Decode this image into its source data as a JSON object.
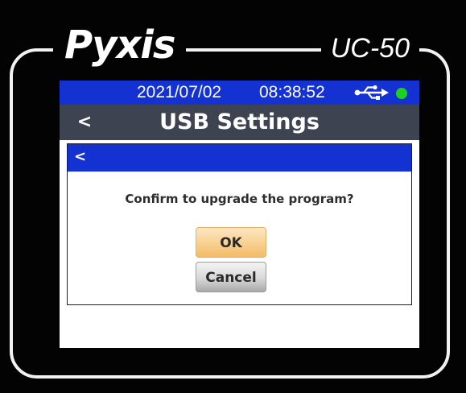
{
  "device": {
    "brand": "Pyxis",
    "model": "UC-50"
  },
  "status_bar": {
    "date": "2021/07/02",
    "time": "08:38:52",
    "usb_icon": "usb-icon",
    "connection_dot_color": "#1dd11d"
  },
  "title_bar": {
    "back_label": "<",
    "title": "USB Settings"
  },
  "dialog": {
    "back_label": "<",
    "message": "Confirm to upgrade the program?",
    "ok_label": "OK",
    "cancel_label": "Cancel"
  },
  "colors": {
    "status_bar": "#1431d2",
    "title_bar": "#3e4351",
    "ok_button": "#f8d08f",
    "cancel_button": "#d8d8d8"
  }
}
